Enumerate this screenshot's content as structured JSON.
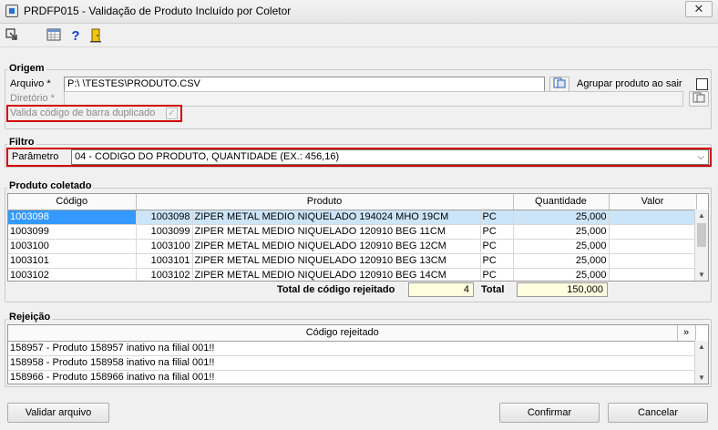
{
  "window": {
    "title": "PRDFP015 - Validação de Produto Incluído por Coletor",
    "close_label": "✕"
  },
  "toolbar": {
    "icons": [
      "exit-arrow-icon",
      "calculator-icon",
      "help-icon",
      "door-exit-icon"
    ],
    "help_label": "?"
  },
  "origem": {
    "title": "Origem",
    "arquivo_label": "Arquivo *",
    "arquivo_value": "P:\\                    \\TESTES\\PRODUTO.CSV",
    "agrupar_label": "Agrupar produto ao sair",
    "diretorio_label": "Diretório *",
    "diretorio_value": "",
    "valida_label": "Valida código de barra duplicado",
    "valida_check": "✓"
  },
  "filtro": {
    "title": "Filtro",
    "parametro_label": "Parâmetro",
    "parametro_value": "04 - CODIGO DO PRODUTO, QUANTIDADE (EX.: 456,16)",
    "dropdown_arrow": "⌵"
  },
  "produto": {
    "title": "Produto coletado",
    "columns": [
      "Código",
      "Produto",
      "Quantidade",
      "Valor"
    ],
    "rows": [
      {
        "codigo": "1003098",
        "prod_code": "1003098",
        "desc": "ZIPER METAL MEDIO NIQUELADO 194024 MHO 19CM",
        "un": "PC",
        "qtd": "25,000",
        "valor": ""
      },
      {
        "codigo": "1003099",
        "prod_code": "1003099",
        "desc": "ZIPER METAL MEDIO NIQUELADO 120910 BEG 11CM",
        "un": "PC",
        "qtd": "25,000",
        "valor": ""
      },
      {
        "codigo": "1003100",
        "prod_code": "1003100",
        "desc": "ZIPER METAL MEDIO NIQUELADO 120910 BEG 12CM",
        "un": "PC",
        "qtd": "25,000",
        "valor": ""
      },
      {
        "codigo": "1003101",
        "prod_code": "1003101",
        "desc": "ZIPER METAL MEDIO NIQUELADO 120910 BEG 13CM",
        "un": "PC",
        "qtd": "25,000",
        "valor": ""
      },
      {
        "codigo": "1003102",
        "prod_code": "1003102",
        "desc": "ZIPER METAL MEDIO NIQUELADO 120910 BEG 14CM",
        "un": "PC",
        "qtd": "25,000",
        "valor": ""
      }
    ],
    "total_rejeitado_label": "Total de código rejeitado",
    "total_rejeitado_value": "4",
    "total_label": "Total",
    "total_value": "150,000"
  },
  "rejeicao": {
    "title": "Rejeição",
    "column": "Código rejeitado",
    "expand_label": "»",
    "rows": [
      "158957 - Produto 158957 inativo na filial 001!!",
      "158958 - Produto 158958 inativo na filial 001!!",
      "158966 - Produto 158966 inativo na filial 001!!"
    ]
  },
  "buttons": {
    "validar": "Validar arquivo",
    "confirmar": "Confirmar",
    "cancelar": "Cancelar"
  },
  "colors": {
    "highlight": "#d00000",
    "selection": "#3399ff",
    "total_bg": "#ffffe0"
  }
}
